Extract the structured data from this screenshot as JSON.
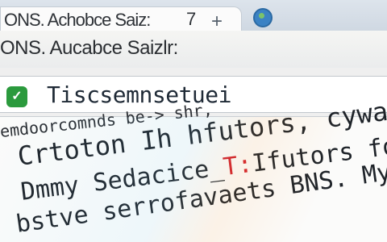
{
  "tab": {
    "title": "ONS. Achobce Saiz:",
    "count": "7",
    "new_tab_symbol": "+"
  },
  "toolbar": {
    "text": "ONS. Aucabce Saizlr:"
  },
  "address_bar": {
    "url": "Tiscsemnsetuei",
    "lock_symbol": "✓"
  },
  "content": {
    "line1": "emdoorcomnds be-> shr,",
    "line2_main": "Crtoton Ih",
    "line2_tail": "hfutors, cywarn",
    "line3_main": "Dmmy Sedacice_",
    "line3_red": "T:",
    "line3_tail": "Ifutors for the",
    "line4": "bstve serrofavaets BNS. My IP.]"
  },
  "colors": {
    "secure_green": "#2b9a3d",
    "cursor_red": "#d1202a"
  }
}
